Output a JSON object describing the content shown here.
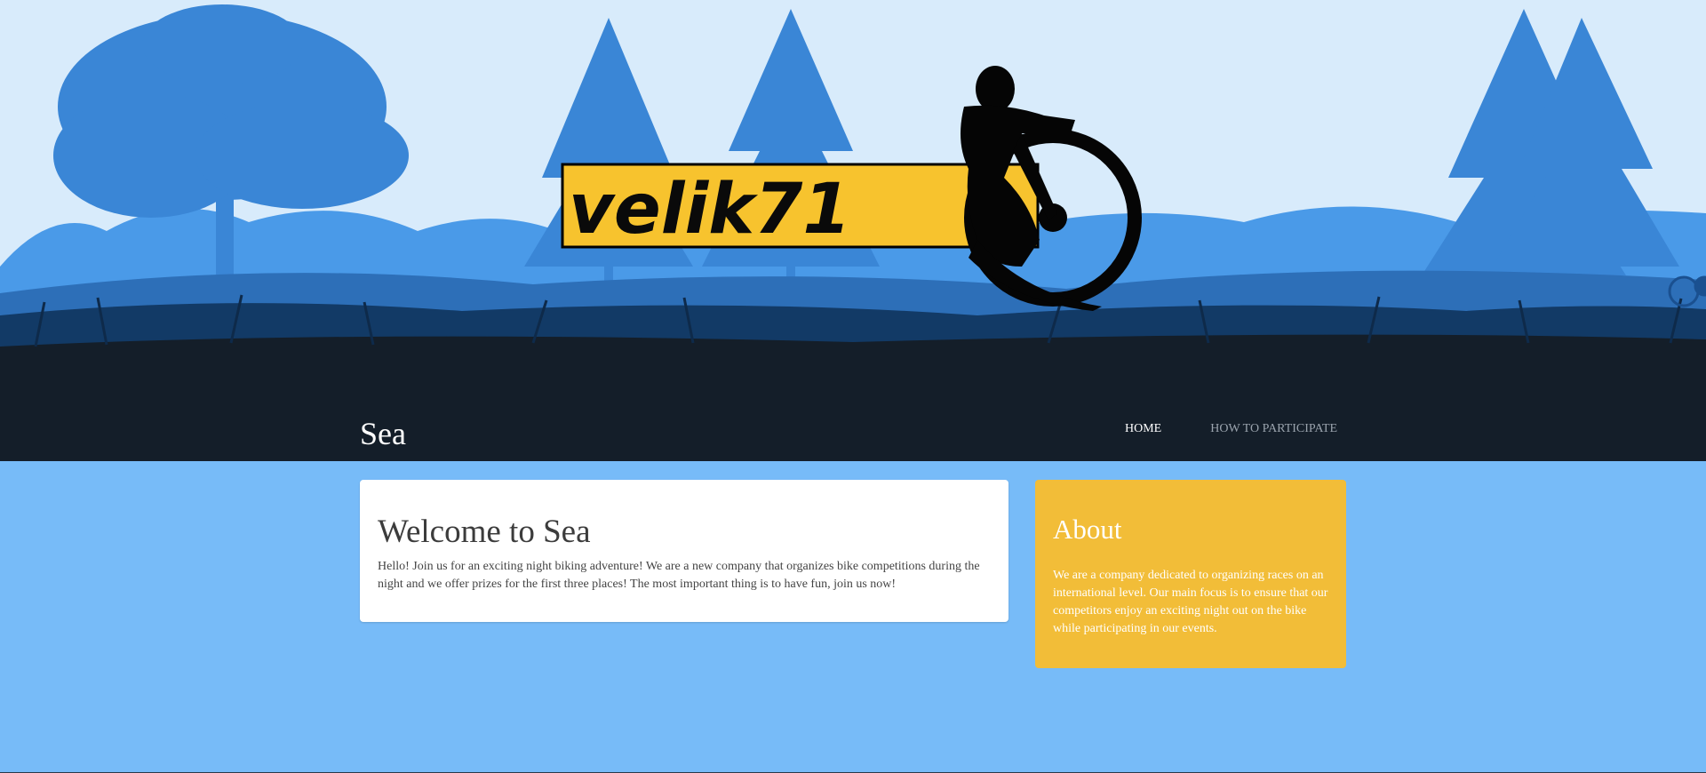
{
  "header": {
    "logo_text": "velik71",
    "site_title": "Sea"
  },
  "nav": {
    "items": [
      {
        "label": "HOME",
        "active": true
      },
      {
        "label": "HOW TO PARTICIPATE",
        "active": false
      }
    ]
  },
  "welcome": {
    "title": "Welcome to Sea",
    "body": "Hello! Join us for an exciting night biking adventure! We are a new company that organizes bike competitions during the night and we offer prizes for the first three places! The most important thing is to have fun, join us now!"
  },
  "about": {
    "title": "About",
    "body": "We are a company dedicated to organizing races on an international level. Our main focus is to ensure that our competitors enjoy an exciting night out on the bike while participating in our events."
  },
  "colors": {
    "page_bg": "#77bbf8",
    "hero_dark": "#141e29",
    "sky": "#d8ebfb",
    "about_bg": "#f2bd38",
    "logo_yellow": "#f7c32e"
  }
}
